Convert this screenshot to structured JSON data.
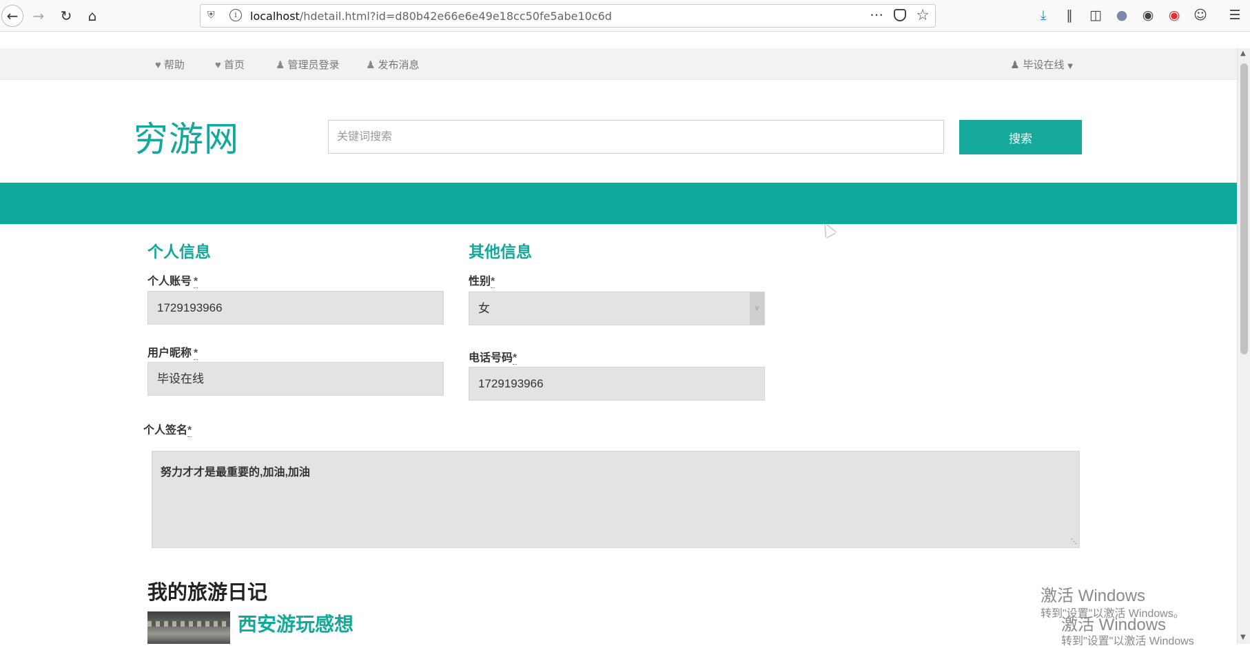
{
  "browser": {
    "url_host": "localhost",
    "url_path": "/hdetail.html?id=d80b42e66e6e49e18cc50fe5abe10c6d",
    "toolbar_icons": [
      "download-icon",
      "library-icon",
      "sidebar-icon",
      "chat-icon",
      "extension-icon",
      "record-icon",
      "account-icon",
      "menu-icon"
    ]
  },
  "topnav": {
    "items": [
      {
        "icon": "heart-icon",
        "label": "帮助"
      },
      {
        "icon": "heart-icon",
        "label": "首页"
      },
      {
        "icon": "user-icon",
        "label": "管理员登录"
      },
      {
        "icon": "user-icon",
        "label": "发布消息"
      }
    ],
    "user_label": "毕设在线"
  },
  "header": {
    "logo": "穷游网",
    "search_placeholder": "关键词搜索",
    "search_button": "搜索"
  },
  "personal": {
    "title": "个人信息",
    "account_label": "个人账号",
    "account_value": "1729193966",
    "nickname_label": "用户昵称",
    "nickname_value": "毕设在线"
  },
  "other": {
    "title": "其他信息",
    "gender_label": "性别",
    "gender_value": "女",
    "phone_label": "电话号码",
    "phone_value": "1729193966"
  },
  "signature": {
    "label": "个人签名",
    "value": "努力才才是最重要的,加油,加油"
  },
  "required_mark": "*",
  "diary": {
    "heading": "我的旅游日记",
    "first_title": "西安游玩感想"
  },
  "watermark": {
    "line1": "激活 Windows",
    "line2": "转到\"设置\"以激活 Windows。",
    "line3": "激活 Windows",
    "line4": "转到\"设置\"以激活 Windows"
  },
  "colors": {
    "accent": "#12a89a",
    "banner": "#0ea89c"
  }
}
